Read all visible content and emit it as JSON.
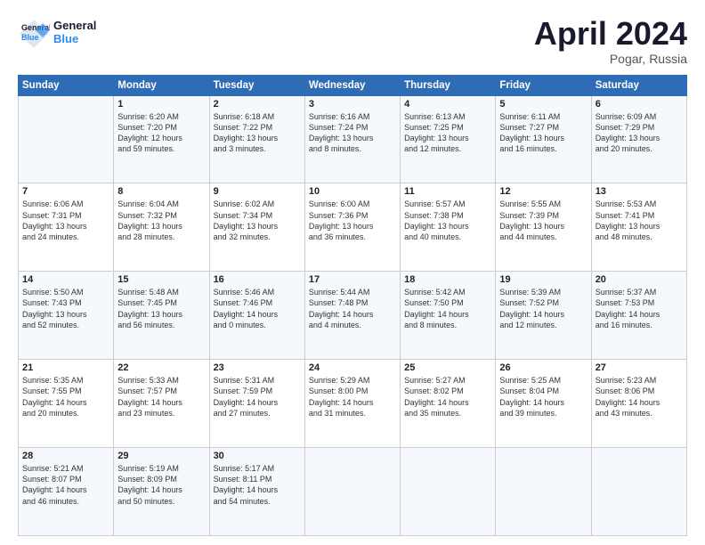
{
  "header": {
    "logo_line1": "General",
    "logo_line2": "Blue",
    "month": "April 2024",
    "location": "Pogar, Russia"
  },
  "weekdays": [
    "Sunday",
    "Monday",
    "Tuesday",
    "Wednesday",
    "Thursday",
    "Friday",
    "Saturday"
  ],
  "weeks": [
    [
      {
        "day": "",
        "info": ""
      },
      {
        "day": "1",
        "info": "Sunrise: 6:20 AM\nSunset: 7:20 PM\nDaylight: 12 hours\nand 59 minutes."
      },
      {
        "day": "2",
        "info": "Sunrise: 6:18 AM\nSunset: 7:22 PM\nDaylight: 13 hours\nand 3 minutes."
      },
      {
        "day": "3",
        "info": "Sunrise: 6:16 AM\nSunset: 7:24 PM\nDaylight: 13 hours\nand 8 minutes."
      },
      {
        "day": "4",
        "info": "Sunrise: 6:13 AM\nSunset: 7:25 PM\nDaylight: 13 hours\nand 12 minutes."
      },
      {
        "day": "5",
        "info": "Sunrise: 6:11 AM\nSunset: 7:27 PM\nDaylight: 13 hours\nand 16 minutes."
      },
      {
        "day": "6",
        "info": "Sunrise: 6:09 AM\nSunset: 7:29 PM\nDaylight: 13 hours\nand 20 minutes."
      }
    ],
    [
      {
        "day": "7",
        "info": "Sunrise: 6:06 AM\nSunset: 7:31 PM\nDaylight: 13 hours\nand 24 minutes."
      },
      {
        "day": "8",
        "info": "Sunrise: 6:04 AM\nSunset: 7:32 PM\nDaylight: 13 hours\nand 28 minutes."
      },
      {
        "day": "9",
        "info": "Sunrise: 6:02 AM\nSunset: 7:34 PM\nDaylight: 13 hours\nand 32 minutes."
      },
      {
        "day": "10",
        "info": "Sunrise: 6:00 AM\nSunset: 7:36 PM\nDaylight: 13 hours\nand 36 minutes."
      },
      {
        "day": "11",
        "info": "Sunrise: 5:57 AM\nSunset: 7:38 PM\nDaylight: 13 hours\nand 40 minutes."
      },
      {
        "day": "12",
        "info": "Sunrise: 5:55 AM\nSunset: 7:39 PM\nDaylight: 13 hours\nand 44 minutes."
      },
      {
        "day": "13",
        "info": "Sunrise: 5:53 AM\nSunset: 7:41 PM\nDaylight: 13 hours\nand 48 minutes."
      }
    ],
    [
      {
        "day": "14",
        "info": "Sunrise: 5:50 AM\nSunset: 7:43 PM\nDaylight: 13 hours\nand 52 minutes."
      },
      {
        "day": "15",
        "info": "Sunrise: 5:48 AM\nSunset: 7:45 PM\nDaylight: 13 hours\nand 56 minutes."
      },
      {
        "day": "16",
        "info": "Sunrise: 5:46 AM\nSunset: 7:46 PM\nDaylight: 14 hours\nand 0 minutes."
      },
      {
        "day": "17",
        "info": "Sunrise: 5:44 AM\nSunset: 7:48 PM\nDaylight: 14 hours\nand 4 minutes."
      },
      {
        "day": "18",
        "info": "Sunrise: 5:42 AM\nSunset: 7:50 PM\nDaylight: 14 hours\nand 8 minutes."
      },
      {
        "day": "19",
        "info": "Sunrise: 5:39 AM\nSunset: 7:52 PM\nDaylight: 14 hours\nand 12 minutes."
      },
      {
        "day": "20",
        "info": "Sunrise: 5:37 AM\nSunset: 7:53 PM\nDaylight: 14 hours\nand 16 minutes."
      }
    ],
    [
      {
        "day": "21",
        "info": "Sunrise: 5:35 AM\nSunset: 7:55 PM\nDaylight: 14 hours\nand 20 minutes."
      },
      {
        "day": "22",
        "info": "Sunrise: 5:33 AM\nSunset: 7:57 PM\nDaylight: 14 hours\nand 23 minutes."
      },
      {
        "day": "23",
        "info": "Sunrise: 5:31 AM\nSunset: 7:59 PM\nDaylight: 14 hours\nand 27 minutes."
      },
      {
        "day": "24",
        "info": "Sunrise: 5:29 AM\nSunset: 8:00 PM\nDaylight: 14 hours\nand 31 minutes."
      },
      {
        "day": "25",
        "info": "Sunrise: 5:27 AM\nSunset: 8:02 PM\nDaylight: 14 hours\nand 35 minutes."
      },
      {
        "day": "26",
        "info": "Sunrise: 5:25 AM\nSunset: 8:04 PM\nDaylight: 14 hours\nand 39 minutes."
      },
      {
        "day": "27",
        "info": "Sunrise: 5:23 AM\nSunset: 8:06 PM\nDaylight: 14 hours\nand 43 minutes."
      }
    ],
    [
      {
        "day": "28",
        "info": "Sunrise: 5:21 AM\nSunset: 8:07 PM\nDaylight: 14 hours\nand 46 minutes."
      },
      {
        "day": "29",
        "info": "Sunrise: 5:19 AM\nSunset: 8:09 PM\nDaylight: 14 hours\nand 50 minutes."
      },
      {
        "day": "30",
        "info": "Sunrise: 5:17 AM\nSunset: 8:11 PM\nDaylight: 14 hours\nand 54 minutes."
      },
      {
        "day": "",
        "info": ""
      },
      {
        "day": "",
        "info": ""
      },
      {
        "day": "",
        "info": ""
      },
      {
        "day": "",
        "info": ""
      }
    ]
  ]
}
